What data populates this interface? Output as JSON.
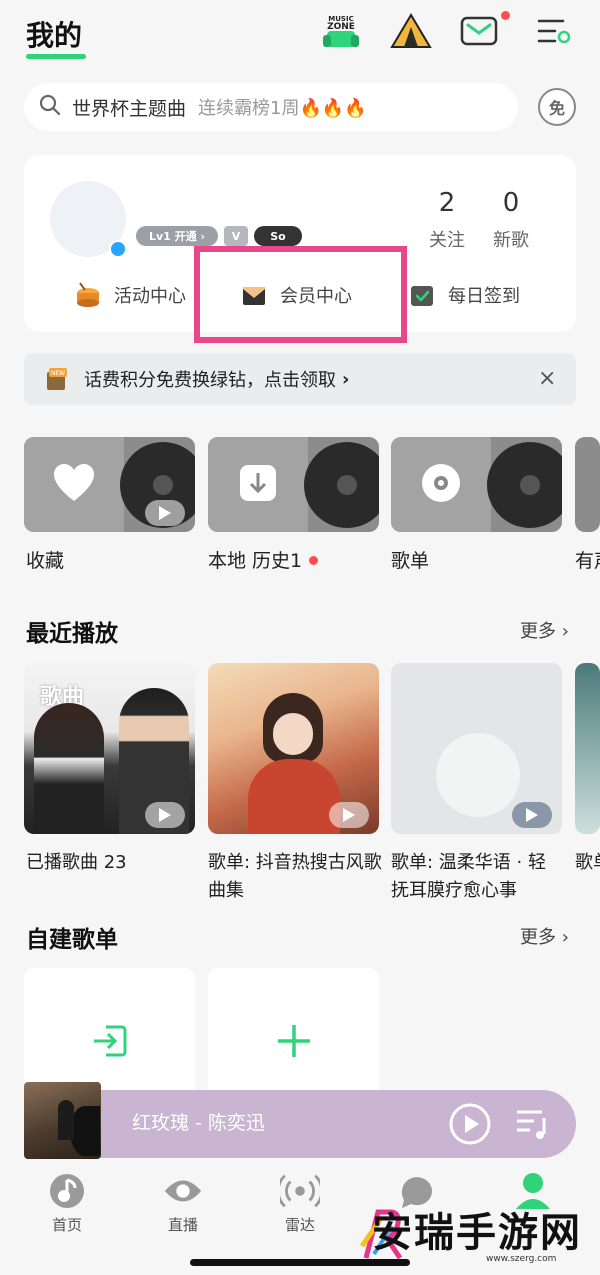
{
  "header": {
    "title": "我的",
    "icons": [
      "music-zone-icon",
      "tent-icon",
      "mail-icon",
      "menu-icon"
    ]
  },
  "search": {
    "main": "世界杯主题曲",
    "sub": "连续霸榜1周🔥🔥🔥",
    "free_label": "免"
  },
  "profile": {
    "badges": [
      "Lv1 开通 ›",
      "V",
      "So"
    ],
    "stats": [
      {
        "value": "2",
        "label": "关注"
      },
      {
        "value": "0",
        "label": "新歌"
      }
    ],
    "quick_links": [
      {
        "label": "活动中心",
        "icon": "drum-icon"
      },
      {
        "label": "会员中心",
        "icon": "envelope-icon"
      },
      {
        "label": "每日签到",
        "icon": "calendar-check-icon"
      }
    ]
  },
  "promo": {
    "text": "话费积分免费换绿钻，点击领取",
    "arrow": "›",
    "close": "×",
    "tag": "NEW"
  },
  "tiles": [
    {
      "label": "收藏",
      "icon": "heart-icon"
    },
    {
      "label": "本地 历史1",
      "icon": "download-icon"
    },
    {
      "label": "歌单",
      "icon": "disc-icon"
    },
    {
      "label": "有声",
      "icon": ""
    }
  ],
  "recent": {
    "title": "最近播放",
    "more": "更多",
    "cover_overlay": "歌曲",
    "items": [
      {
        "label": "已播歌曲 23"
      },
      {
        "label": "歌单: 抖音热搜古风歌曲集"
      },
      {
        "label": "歌单: 温柔华语 · 轻抚耳膜疗愈心事"
      },
      {
        "label": "歌单"
      }
    ]
  },
  "playlists": {
    "title": "自建歌单",
    "more": "更多"
  },
  "player": {
    "track": "红玫瑰 - 陈奕迅"
  },
  "nav": [
    {
      "label": "首页",
      "icon": "home-note-icon"
    },
    {
      "label": "直播",
      "icon": "eye-icon"
    },
    {
      "label": "雷达",
      "icon": "radar-icon"
    },
    {
      "label": "",
      "icon": "chat-bubble-icon"
    },
    {
      "label": "",
      "icon": "profile-icon"
    }
  ],
  "watermark": {
    "text": "安瑞手游网",
    "url": "www.szerg.com"
  },
  "colors": {
    "accent": "#2fd37a",
    "highlight": "#e8488a",
    "player_bg": "#c9b4d1"
  }
}
